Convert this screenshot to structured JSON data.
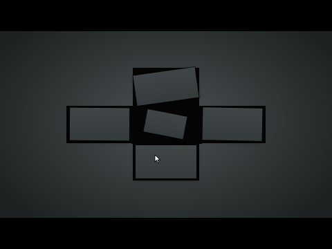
{
  "scene": {
    "description_free": true,
    "colors": {
      "background_center": "#4a5152",
      "background_edge": "#1d2122",
      "slot": "#050505",
      "card": "#3c4243",
      "letterbox": "#000000"
    },
    "pieces": [
      {
        "name": "top"
      },
      {
        "name": "left"
      },
      {
        "name": "center"
      },
      {
        "name": "right"
      },
      {
        "name": "bottom"
      }
    ]
  },
  "cursor": {
    "icon": "arrow-cursor-icon"
  }
}
